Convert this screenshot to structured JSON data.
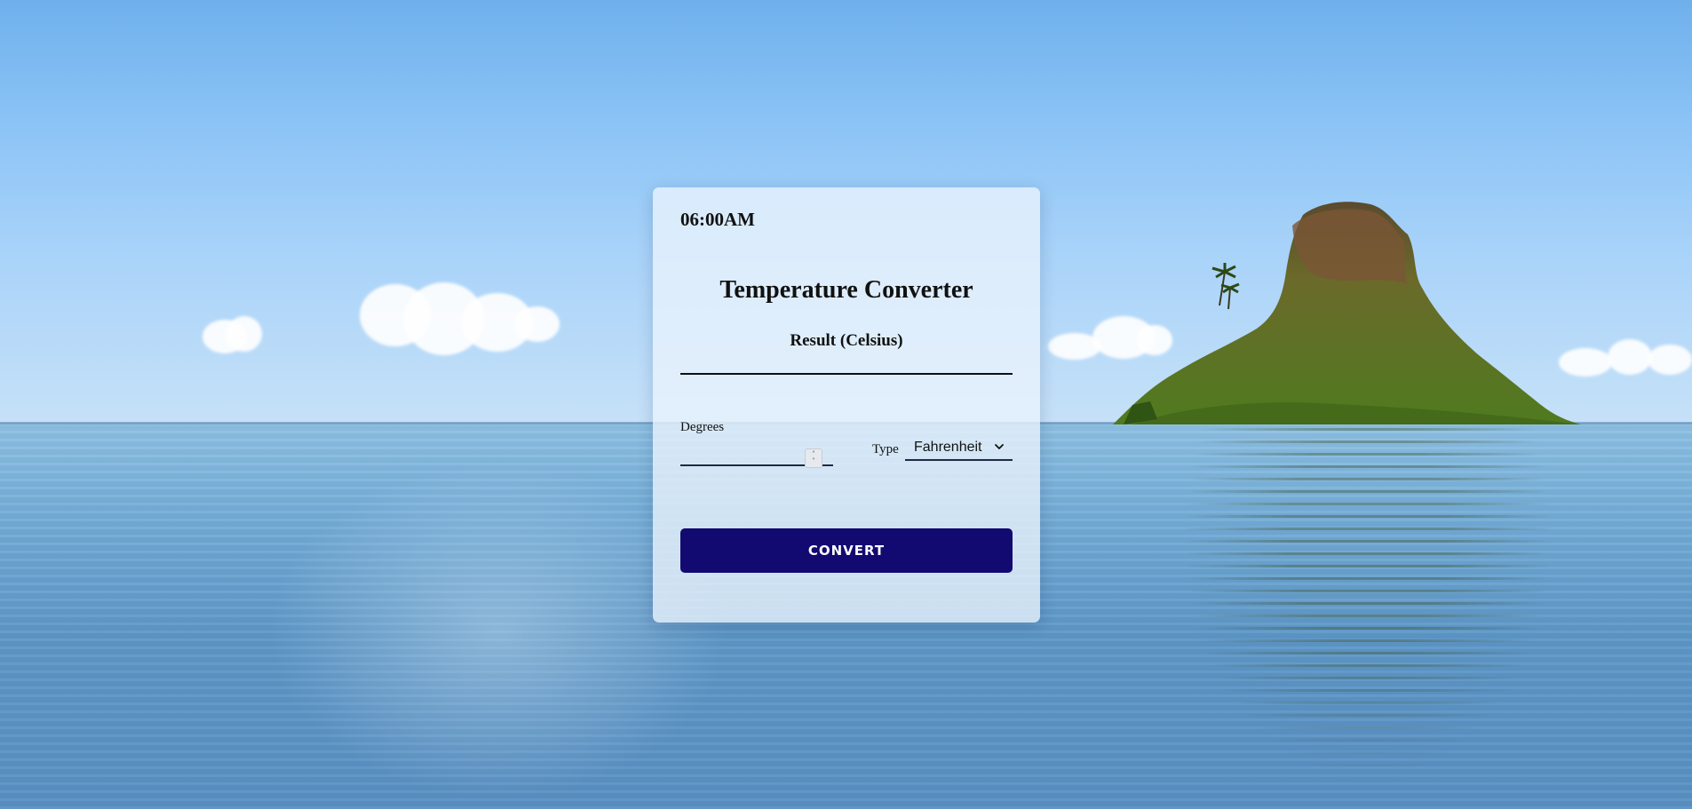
{
  "clock": {
    "time": "06:00AM"
  },
  "converter": {
    "title": "Temperature Converter",
    "result_label": "Result (Celsius)",
    "result_value": "",
    "degrees": {
      "label": "Degrees",
      "value": ""
    },
    "type": {
      "label": "Type",
      "selected": "Fahrenheit"
    },
    "convert_label": "CONVERT"
  },
  "colors": {
    "button": "#120a70",
    "card": "#ebf3fc",
    "underline": "#1f2a44"
  },
  "icons": {
    "spinner": "up-down-spinner-icon",
    "select": "chevron-down-icon"
  }
}
